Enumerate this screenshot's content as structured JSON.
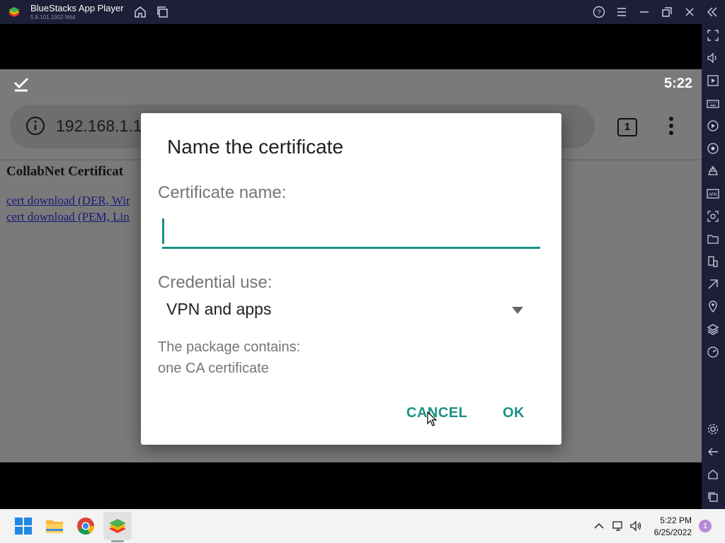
{
  "titlebar": {
    "app_name": "BlueStacks App Player",
    "version": "5.8.101.1002  N64"
  },
  "android": {
    "status_time": "5:22",
    "url": "192.168.1.1",
    "tab_count": "1",
    "page_heading": "CollabNet Certificat",
    "links": [
      "cert download (DER, Wir",
      "cert download (PEM, Lin"
    ]
  },
  "dialog": {
    "title": "Name the certificate",
    "cert_name_label": "Certificate name:",
    "cert_name_value": "",
    "credential_label": "Credential use:",
    "credential_value": "VPN and apps",
    "package_line1": "The package contains:",
    "package_line2": "one CA certificate",
    "cancel_label": "CANCEL",
    "ok_label": "OK"
  },
  "taskbar": {
    "time": "5:22 PM",
    "date": "6/25/2022",
    "notification_count": "1"
  },
  "colors": {
    "accent_teal": "#1a9183",
    "titlebar_bg": "#1c1f36",
    "taskbar_bg": "#f3f3f3"
  },
  "icons": {
    "titlebar": [
      "bluestacks-logo",
      "home-icon",
      "multi-instance-icon",
      "help-icon",
      "menu-icon",
      "minimize-icon",
      "restore-icon",
      "close-icon",
      "collapse-sidebar-icon"
    ],
    "sidebar": [
      "fullscreen-icon",
      "volume-icon",
      "media-icon",
      "keyboard-icon",
      "macro-icon",
      "sync-icon",
      "build-icon",
      "apk-icon",
      "screenshot-icon",
      "folder-icon",
      "multi-device-icon",
      "eco-icon",
      "location-icon",
      "layers-icon",
      "speed-icon",
      "settings-icon",
      "back-icon",
      "android-home-icon",
      "recents-icon"
    ],
    "taskbar": [
      "windows-start-icon",
      "file-explorer-icon",
      "chrome-icon",
      "bluestacks-taskbar-icon",
      "chevron-up-icon",
      "network-icon",
      "speaker-icon"
    ]
  }
}
